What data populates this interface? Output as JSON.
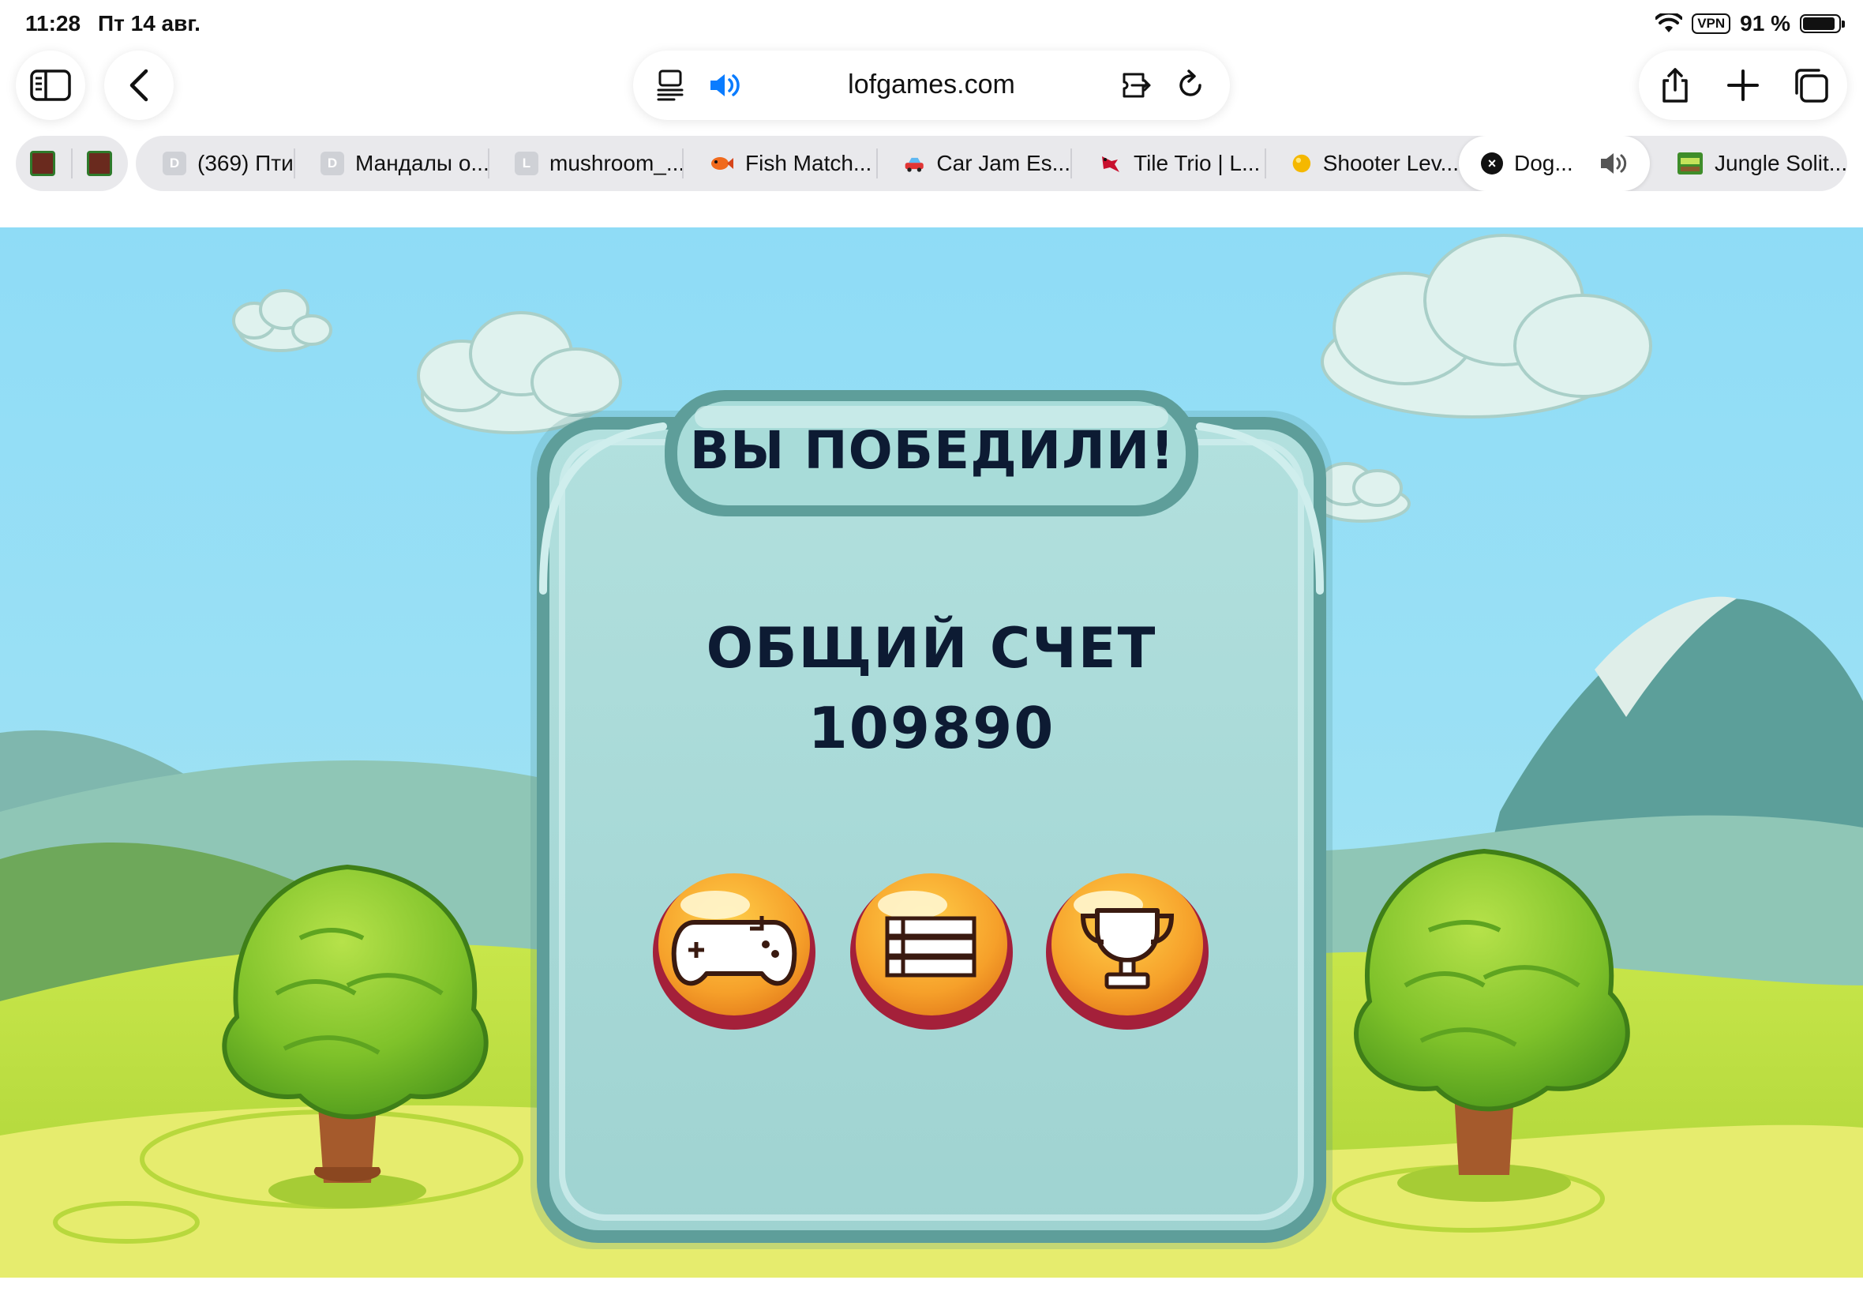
{
  "status_bar": {
    "time": "11:28",
    "date": "Пт 14 авг.",
    "vpn": "VPN",
    "battery": "91 %",
    "battery_level": 0.91
  },
  "toolbar": {
    "url": "lofgames.com",
    "icons": [
      "sidebar-icon",
      "back-icon",
      "reader-icon",
      "speaker-icon",
      "extension-icon",
      "reload-icon",
      "share-icon",
      "new-tab-icon",
      "tabs-overview-icon"
    ],
    "accent": "#0a7cff"
  },
  "tabs": {
    "pinned": [
      "pinned-tab",
      "pinned-tab"
    ],
    "items": [
      {
        "fav": "D",
        "title": "(369) Пти"
      },
      {
        "fav": "D",
        "title": "Мандалы о..."
      },
      {
        "fav": "L",
        "title": "mushroom_..."
      },
      {
        "fav": "fish-icon",
        "title": "Fish Match..."
      },
      {
        "fav": "car-icon",
        "title": "Car Jam Es..."
      },
      {
        "fav": "bird-icon",
        "title": "Tile Trio | L..."
      },
      {
        "fav": "ball-icon",
        "title": "Shooter Lev..."
      },
      {
        "fav": "close-icon",
        "title": "Dog...",
        "active": true,
        "audio": true
      },
      {
        "fav": "jungle-icon",
        "title": "Jungle Solit..."
      }
    ]
  },
  "game": {
    "title": "ВЫ ПОБЕДИЛИ!",
    "score_label": "ОБЩИЙ СЧЕТ",
    "score": "109890",
    "buttons": [
      "gamepad-icon",
      "menu-list-icon",
      "trophy-icon"
    ],
    "colors": {
      "sky": "#93dcf5",
      "panel": "#a9dbdb",
      "panel_border": "#5e9e9a",
      "button_orange": "#f5a42c",
      "button_rim": "#a4203a",
      "tree": "#7cc22a",
      "grass": "#b9dd3e"
    }
  }
}
